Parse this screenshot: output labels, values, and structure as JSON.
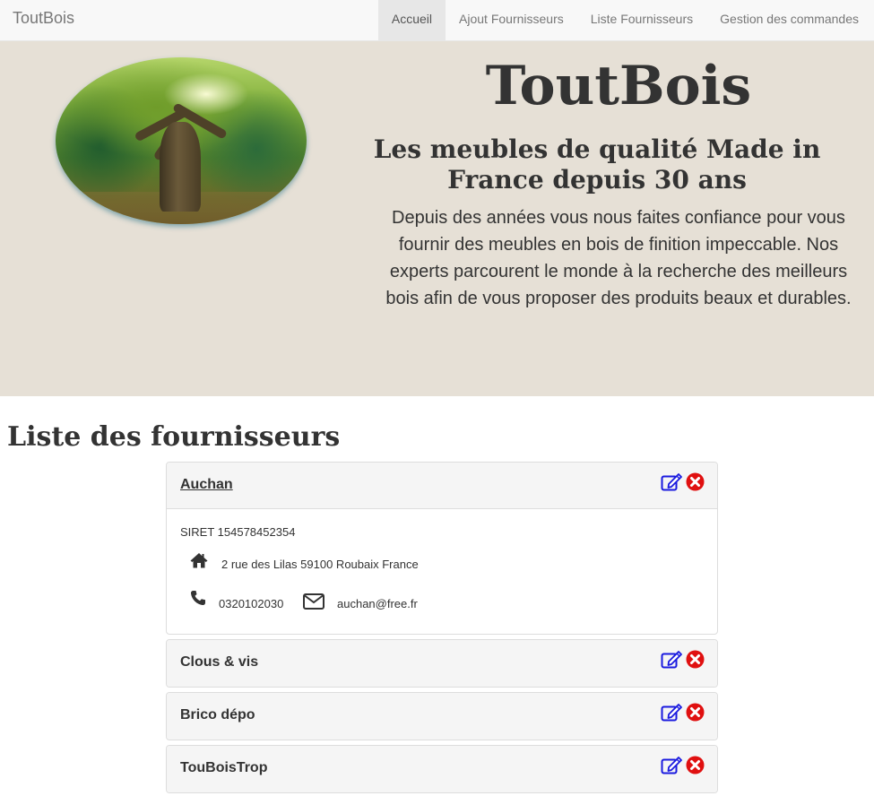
{
  "navbar": {
    "brand": "ToutBois",
    "links": [
      {
        "label": "Accueil",
        "active": true
      },
      {
        "label": "Ajout Fournisseurs",
        "active": false
      },
      {
        "label": "Liste Fournisseurs",
        "active": false
      },
      {
        "label": "Gestion des commandes",
        "active": false
      }
    ]
  },
  "hero": {
    "title": "ToutBois",
    "subtitle": "Les meubles de qualité Made in France depuis 30 ans",
    "text": "Depuis des années vous nous faites confiance pour vous fournir des meubles en bois de finition impeccable. Nos experts parcourent le monde à la recherche des meilleurs bois afin de vous proposer des produits beaux et durables.",
    "background": "#e6e0d6"
  },
  "section": {
    "title": "Liste des fournisseurs"
  },
  "suppliers": [
    {
      "name": "Auchan",
      "expanded": true,
      "siret": "SIRET 154578452354",
      "address": "2 rue des Lilas 59100 Roubaix France",
      "phone": "0320102030",
      "email": "auchan@free.fr"
    },
    {
      "name": "Clous & vis",
      "expanded": false
    },
    {
      "name": "Brico dépo",
      "expanded": false
    },
    {
      "name": "TouBoisTrop",
      "expanded": false
    }
  ],
  "icons": {
    "edit": "edit-icon",
    "delete": "delete-icon",
    "home": "home-icon",
    "phone": "phone-icon",
    "mail": "mail-icon"
  },
  "colors": {
    "edit_icon": "#1a1adf",
    "delete_icon": "#e01010",
    "navbar_bg": "#f8f8f8",
    "panel_heading_bg": "#f5f5f5"
  }
}
